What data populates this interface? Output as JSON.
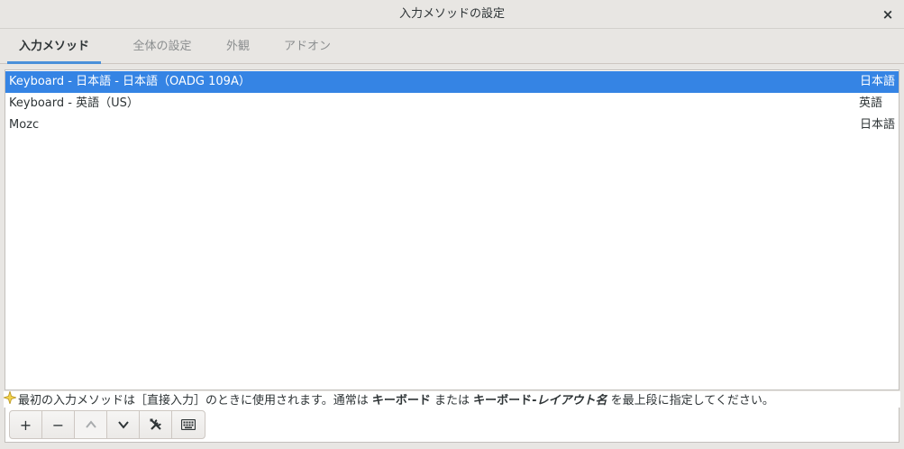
{
  "window": {
    "title": "入力メソッドの設定",
    "close_label": "×"
  },
  "tabs": [
    {
      "label": "入力メソッド",
      "active": true
    },
    {
      "label": "全体の設定",
      "active": false
    },
    {
      "label": "外観",
      "active": false
    },
    {
      "label": "アドオン",
      "active": false
    }
  ],
  "methods": [
    {
      "name": "Keyboard - 日本語 - 日本語（OADG 109A）",
      "language": "日本語",
      "selected": true
    },
    {
      "name": "Keyboard - 英語（US）",
      "language": "英語",
      "selected": false
    },
    {
      "name": "Mozc",
      "language": "日本語",
      "selected": false
    }
  ],
  "hint": {
    "part1": "最初の入力メソッドは［直接入力］のときに使用されます。通常は ",
    "bold1": "キーボード",
    "part2": " または ",
    "bold2": "キーボード-",
    "italic": "レイアウト名",
    "part3": " を最上段に指定してください。"
  },
  "toolbar": {
    "add_label": "+",
    "remove_label": "−"
  },
  "colors": {
    "accent": "#3584e4",
    "tab_underline": "#4a90d9"
  }
}
